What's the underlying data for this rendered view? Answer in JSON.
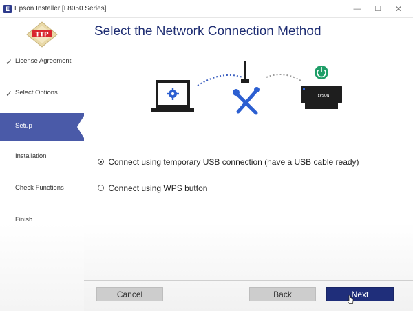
{
  "window": {
    "title": "Epson Installer [L8050 Series]",
    "icon_letter": "E",
    "minimize_glyph": "—",
    "maximize_glyph": "☐",
    "close_glyph": "✕"
  },
  "logo": {
    "text": "TTP"
  },
  "sidebar": {
    "items": [
      {
        "label": "License Agreement",
        "completed": true,
        "active": false
      },
      {
        "label": "Select Options",
        "completed": true,
        "active": false
      },
      {
        "label": "Setup",
        "completed": false,
        "active": true
      },
      {
        "label": "Installation",
        "completed": false,
        "active": false
      },
      {
        "label": "Check Functions",
        "completed": false,
        "active": false
      },
      {
        "label": "Finish",
        "completed": false,
        "active": false
      }
    ],
    "check_glyph": "✓"
  },
  "main": {
    "title": "Select the Network Connection Method",
    "illustration": {
      "printer_brand": "EPSON",
      "icons": [
        "laptop-gear-icon",
        "router-icon",
        "tools-icon",
        "printer-icon",
        "power-icon"
      ]
    },
    "options": [
      {
        "label": "Connect using temporary USB connection (have a USB cable ready)",
        "selected": true
      },
      {
        "label": "Connect using WPS button",
        "selected": false
      }
    ]
  },
  "buttons": {
    "cancel": "Cancel",
    "back": "Back",
    "next": "Next"
  },
  "colors": {
    "accent": "#4a5aa8",
    "title": "#1f2e73",
    "primary_button": "#1f2e7a",
    "power_green": "#1f9e68"
  }
}
